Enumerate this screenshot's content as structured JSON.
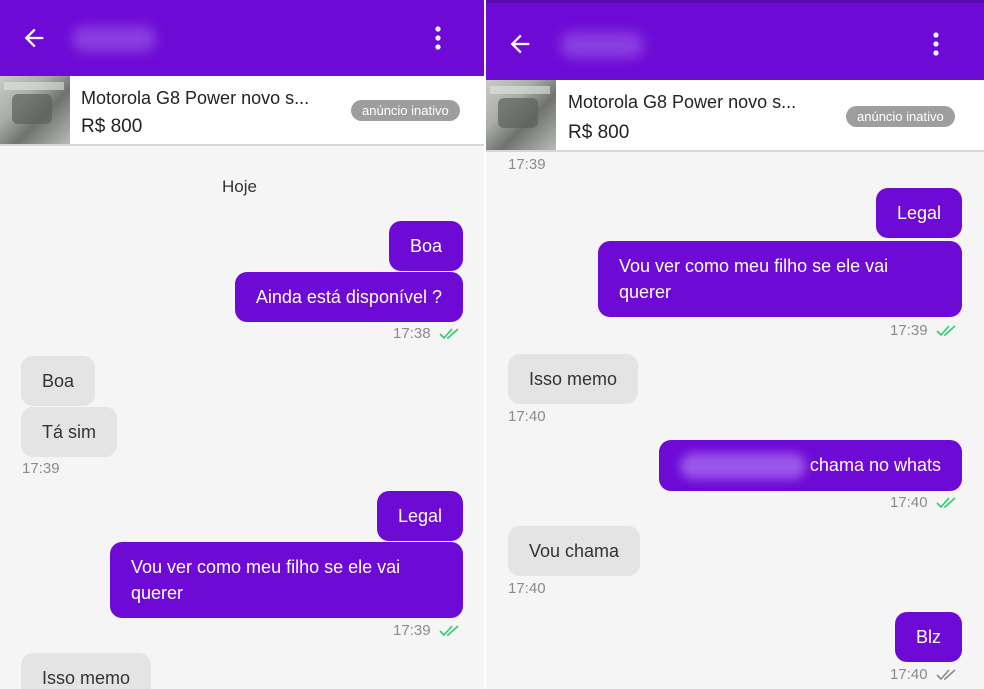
{
  "left_panel": {
    "header": {
      "back": "back-arrow-icon",
      "menu": "more-vertical-icon"
    },
    "ad": {
      "title": "Motorola G8 Power novo s...",
      "price": "R$ 800",
      "status": "anúncio inativo"
    },
    "day_label": "Hoje",
    "messages": [
      {
        "dir": "out",
        "text": "Boa"
      },
      {
        "dir": "out",
        "text": "Ainda está disponível ?",
        "time": "17:38"
      },
      {
        "dir": "in",
        "text": "Boa"
      },
      {
        "dir": "in",
        "text": "Tá sim",
        "time": "17:39"
      },
      {
        "dir": "out",
        "text": "Legal"
      },
      {
        "dir": "out",
        "text": "Vou ver como meu filho se ele vai querer",
        "time": "17:39"
      },
      {
        "dir": "in",
        "text": "Isso memo"
      }
    ]
  },
  "right_panel": {
    "header": {
      "back": "back-arrow-icon",
      "menu": "more-vertical-icon"
    },
    "ad": {
      "title": "Motorola G8 Power novo s...",
      "price": "R$ 800",
      "status": "anúncio inativo"
    },
    "top_time": "17:39",
    "messages": [
      {
        "dir": "out",
        "text": "Legal"
      },
      {
        "dir": "out",
        "text": "Vou ver como meu filho se ele vai querer",
        "time": "17:39"
      },
      {
        "dir": "in",
        "text": "Isso memo",
        "time": "17:40"
      },
      {
        "dir": "out",
        "text": "chama no whats",
        "time": "17:40"
      },
      {
        "dir": "in",
        "text": "Vou chama",
        "time": "17:40"
      },
      {
        "dir": "out",
        "text": "Blz",
        "time": "17:40"
      }
    ]
  },
  "colors": {
    "brand": "#6e0ad6",
    "incoming_bubble": "#e4e4e4",
    "read_tick": "#2ecc71",
    "sent_tick": "#8a8a8a"
  }
}
